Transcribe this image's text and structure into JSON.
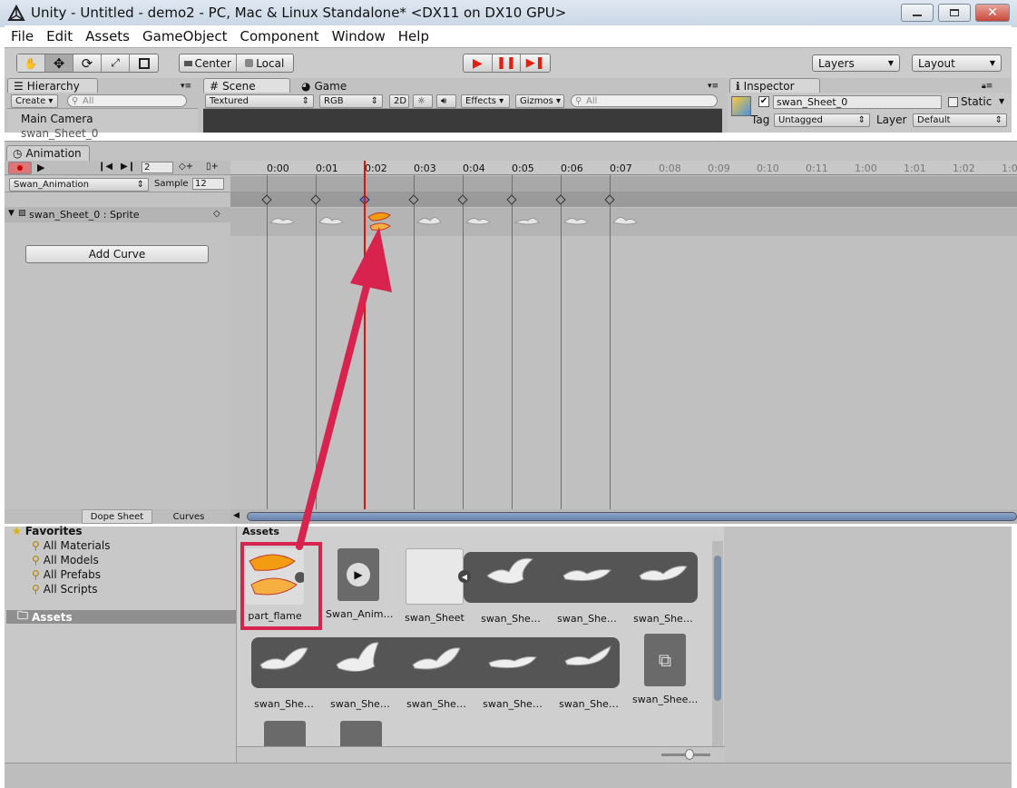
{
  "window": {
    "title": "Unity - Untitled - demo2 - PC, Mac & Linux Standalone* <DX11 on DX10 GPU>"
  },
  "menu": [
    "File",
    "Edit",
    "Assets",
    "GameObject",
    "Component",
    "Window",
    "Help"
  ],
  "toolbar": {
    "pivot_center": "Center",
    "pivot_local": "Local",
    "layers": "Layers",
    "layout": "Layout"
  },
  "hierarchy": {
    "tab": "Hierarchy",
    "create": "Create",
    "search_placeholder": "All",
    "items": [
      "Main Camera",
      "swan_Sheet_0"
    ]
  },
  "scene": {
    "tab": "Scene",
    "shading": "Textured",
    "color": "RGB",
    "mode2d": "2D",
    "effects": "Effects",
    "gizmos": "Gizmos",
    "search_placeholder": "All"
  },
  "game": {
    "tab": "Game"
  },
  "inspector": {
    "tab": "Inspector",
    "object_name": "swan_Sheet_0",
    "static_label": "Static",
    "tag_label": "Tag",
    "tag_value": "Untagged",
    "layer_label": "Layer",
    "layer_value": "Default"
  },
  "animation": {
    "tab": "Animation",
    "frame": "2",
    "clip": "Swan_Animation",
    "sample_label": "Sample",
    "sample_value": "12",
    "property": "swan_Sheet_0 : Sprite",
    "add_curve": "Add Curve",
    "dope_sheet": "Dope Sheet",
    "curves": "Curves",
    "ruler": [
      "0:00",
      "0:01",
      "0:02",
      "0:03",
      "0:04",
      "0:05",
      "0:06",
      "0:07",
      "0:08",
      "0:09",
      "0:10",
      "0:11",
      "1:00",
      "1:01",
      "1:02",
      "1:0"
    ]
  },
  "project": {
    "favorites_label": "Favorites",
    "favorites": [
      "All Materials",
      "All Models",
      "All Prefabs",
      "All Scripts"
    ],
    "assets_folder": "Assets",
    "assets_header": "Assets",
    "row1": [
      "part_flame",
      "Swan_Anim…",
      "swan_Sheet",
      "swan_She…",
      "swan_She…",
      "swan_She…"
    ],
    "row2": [
      "swan_She…",
      "swan_She…",
      "swan_She…",
      "swan_She…",
      "swan_She…",
      "swan_Shee…"
    ]
  },
  "colors": {
    "highlight": "#d8234f",
    "playhead": "#e01010",
    "play_red": "#e02010"
  }
}
